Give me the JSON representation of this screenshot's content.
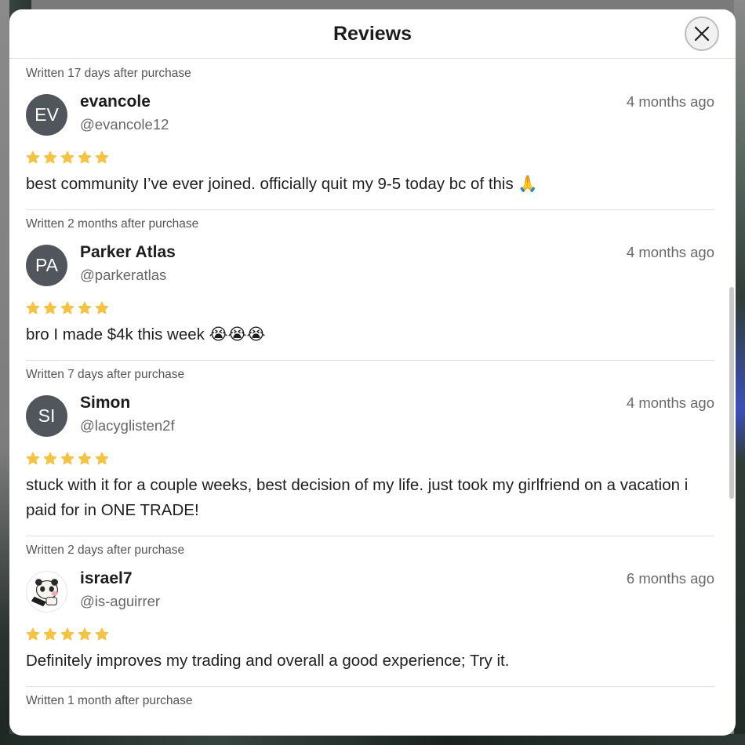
{
  "modal": {
    "title": "Reviews",
    "close_icon": "close-icon"
  },
  "colors": {
    "star": "#f5c344",
    "avatar_bg": "#51555c",
    "divider": "#dedede"
  },
  "reviews": [
    {
      "written": "Written 17 days after purchase",
      "initials": "EV",
      "name": "evancole",
      "handle": "@evancole12",
      "time": "4 months ago",
      "rating": 5,
      "text": "best community I’ve ever joined. officially quit my 9-5 today bc of this 🙏"
    },
    {
      "written": "Written 2 months after purchase",
      "initials": "PA",
      "name": "Parker Atlas",
      "handle": "@parkeratlas",
      "time": "4 months ago",
      "rating": 5,
      "text": "bro I made $4k this week 😭😭😭"
    },
    {
      "written": "Written 7 days after purchase",
      "initials": "SI",
      "name": "Simon",
      "handle": "@lacyglisten2f",
      "time": "4 months ago",
      "rating": 5,
      "text": "stuck with it for a couple weeks, best decision of my life. just took my girlfriend on a vacation i paid for in ONE TRADE!"
    },
    {
      "written": "Written 2 days after purchase",
      "initials": "",
      "name": "israel7",
      "handle": "@is-aguirrer",
      "time": "6 months ago",
      "rating": 5,
      "text": "Definitely improves my trading and overall a good experience; Try it."
    },
    {
      "written": "Written 1 month after purchase"
    }
  ]
}
